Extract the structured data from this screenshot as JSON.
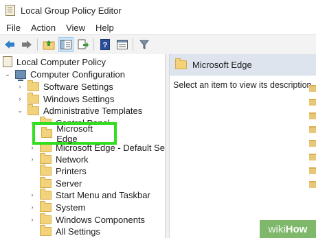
{
  "window": {
    "title": "Local Group Policy Editor",
    "icon": "policy-editor-icon"
  },
  "menu": [
    "File",
    "Action",
    "View",
    "Help"
  ],
  "toolbar": {
    "buttons": [
      "back-arrow-icon",
      "forward-arrow-icon",
      "up-folder-icon",
      "show-hide-tree-icon",
      "export-list-icon",
      "help-icon",
      "properties-icon",
      "filter-icon"
    ]
  },
  "tree": {
    "root": "Local Computer Policy",
    "computer_configuration": "Computer Configuration",
    "software_settings": "Software Settings",
    "windows_settings": "Windows Settings",
    "administrative_templates": "Administrative Templates",
    "control_panel": "Control Panel",
    "microsoft_edge": "Microsoft Edge",
    "microsoft_edge_default": "Microsoft Edge - Default Setting",
    "network": "Network",
    "printers": "Printers",
    "server": "Server",
    "start_menu": "Start Menu and Taskbar",
    "system": "System",
    "windows_components": "Windows Components",
    "all_settings": "All Settings"
  },
  "details": {
    "header": "Microsoft Edge",
    "description": "Select an item to view its description."
  },
  "watermark": {
    "part1": "wiki",
    "part2": "How"
  },
  "colors": {
    "highlight": "#33dd22",
    "header": "#dde4ee",
    "watermark": "#7fb86a"
  }
}
